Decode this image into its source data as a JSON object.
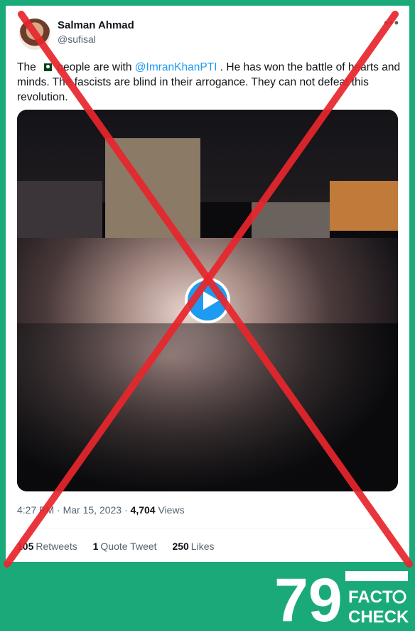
{
  "author": {
    "name": "Salman Ahmad",
    "handle": "@sufisal"
  },
  "tweet": {
    "text_prefix": "The",
    "flag_icon": "pakistan-flag-icon",
    "text_mid": "people are with",
    "mention": "@ImranKhanPTI",
    "text_suffix": ". He has won the battle of hearts and minds. The fascists are blind in their arrogance. They can not defeat this revolution."
  },
  "meta": {
    "time": "4:27 PM",
    "date": "Mar 15, 2023",
    "views_count": "4,704",
    "views_label": "Views"
  },
  "stats": {
    "retweets_count": "105",
    "retweets_label": "Retweets",
    "quotes_count": "1",
    "quotes_label": "Quote Tweet",
    "likes_count": "250",
    "likes_label": "Likes"
  },
  "overlay": {
    "cross_color": "#e8262c",
    "background_color": "#1aaa7a"
  },
  "logo": {
    "number": "79",
    "line1": "FACT",
    "line2": "CHECK"
  }
}
